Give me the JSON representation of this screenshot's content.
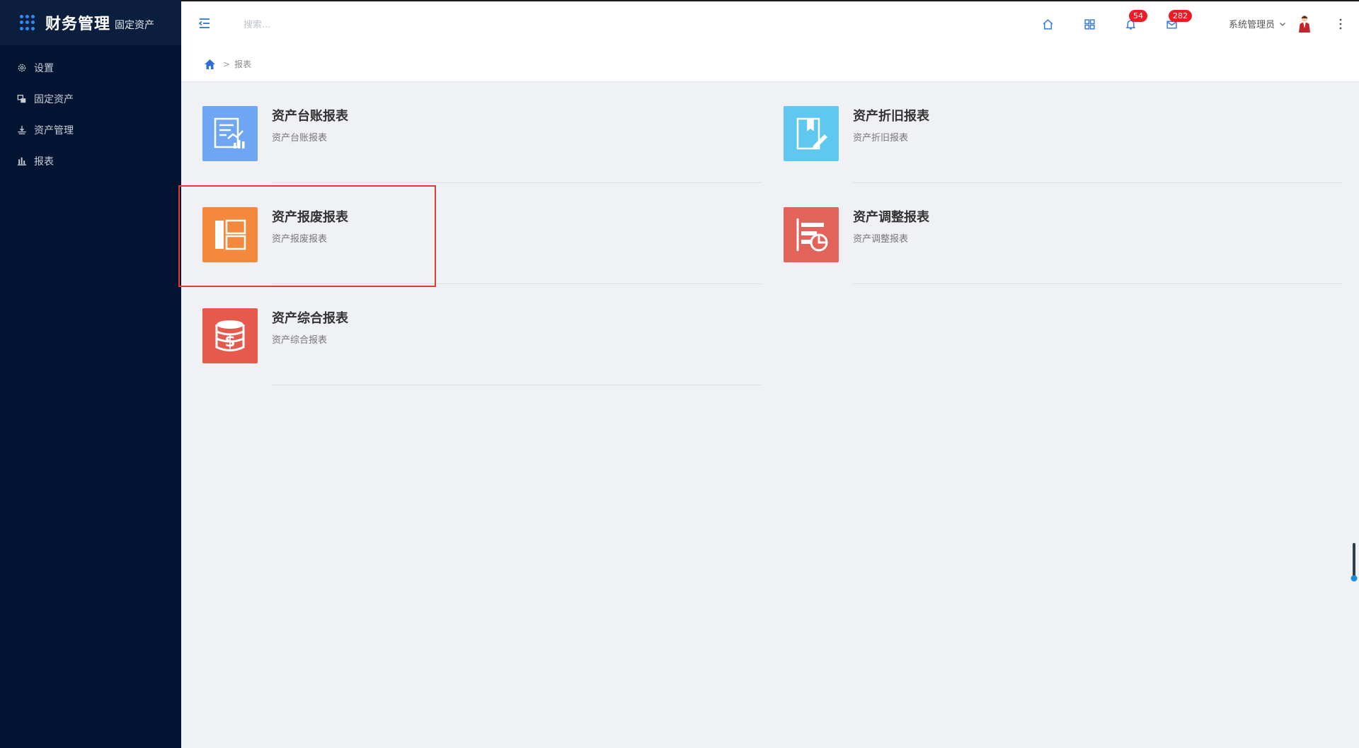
{
  "app": {
    "title": "财务管理",
    "subtitle": "固定资产"
  },
  "sidebar": {
    "items": [
      {
        "label": "设置",
        "icon": "gear-icon"
      },
      {
        "label": "固定资产",
        "icon": "assets-icon"
      },
      {
        "label": "资产管理",
        "icon": "manage-icon"
      },
      {
        "label": "报表",
        "icon": "bar-chart-icon"
      }
    ]
  },
  "header": {
    "search_placeholder": "搜索...",
    "notifications_count": "54",
    "messages_count": "282",
    "user_name": "系统管理员"
  },
  "breadcrumb": {
    "separator": ">",
    "current": "报表"
  },
  "reports": [
    {
      "title": "资产台账报表",
      "desc": "资产台账报表",
      "color": "#6ea6f3",
      "icon": "ledger-report-icon"
    },
    {
      "title": "资产折旧报表",
      "desc": "资产折旧报表",
      "color": "#5ec8ef",
      "icon": "depreciation-report-icon"
    },
    {
      "title": "资产报废报表",
      "desc": "资产报废报表",
      "color": "#f4893e",
      "icon": "scrap-report-icon"
    },
    {
      "title": "资产调整报表",
      "desc": "资产调整报表",
      "color": "#e2635a",
      "icon": "adjust-report-icon"
    },
    {
      "title": "资产综合报表",
      "desc": "资产综合报表",
      "color": "#e55a4c",
      "icon": "summary-report-icon"
    }
  ]
}
